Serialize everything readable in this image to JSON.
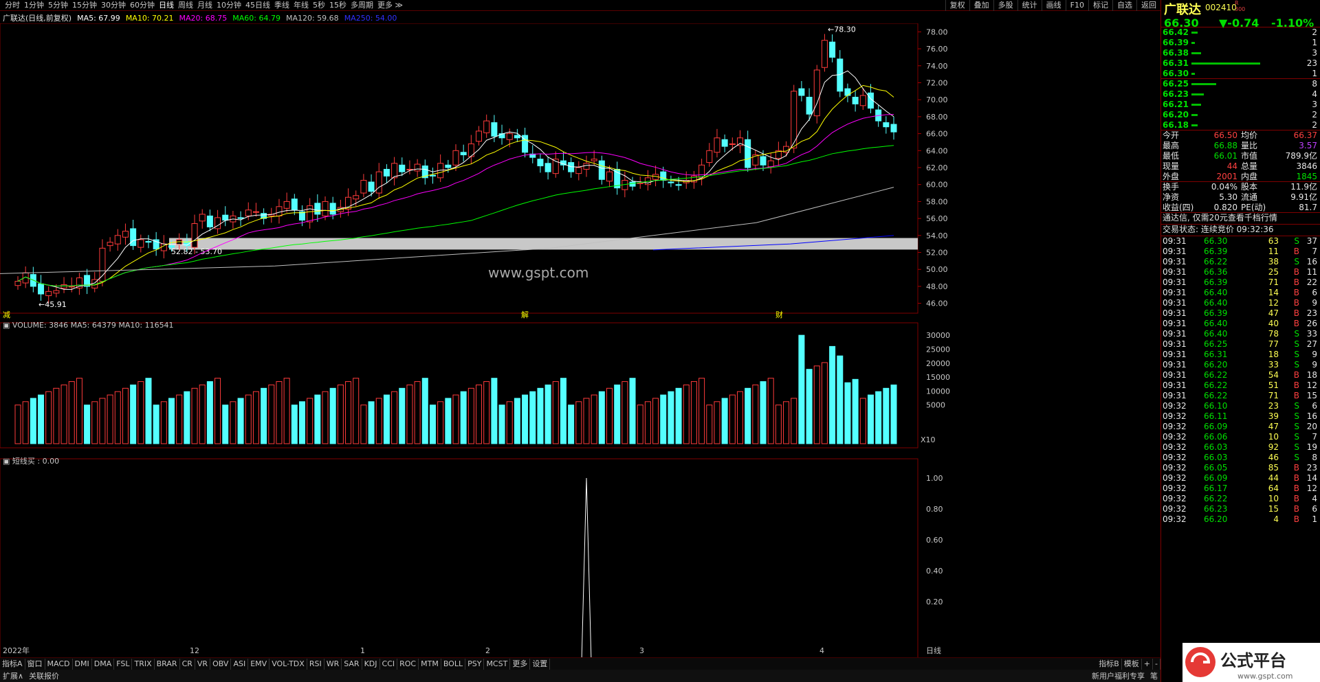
{
  "toolbar": {
    "periods": [
      "分时",
      "1分钟",
      "5分钟",
      "15分钟",
      "30分钟",
      "60分钟",
      "日线",
      "周线",
      "月线",
      "10分钟",
      "45日线",
      "季线",
      "年线",
      "5秒",
      "15秒",
      "多周期",
      "更多 ≫"
    ],
    "right": [
      "复权",
      "叠加",
      "多股",
      "统计",
      "画线",
      "F10",
      "标记",
      "自选",
      "返回"
    ]
  },
  "info": {
    "name": "广联达(日线,前复权)",
    "ma5": "MA5: 67.99",
    "ma10": "MA10: 70.21",
    "ma20": "MA20: 68.75",
    "ma60": "MA60: 64.79",
    "ma120": "MA120: 59.68",
    "ma250": "MA250: 54.00"
  },
  "colors": {
    "up": "#ff3b3b",
    "down": "#54ffff",
    "ma5": "#ffffff",
    "ma10": "#ffff00",
    "ma20": "#ff00ff",
    "ma60": "#00ff00",
    "ma120": "#c0c0c0",
    "ma250": "#0000ff",
    "panel_border": "#800000"
  },
  "chart_data": {
    "type": "candlestick",
    "price_axis": {
      "ticks": [
        "78.00",
        "76.00",
        "74.00",
        "72.00",
        "70.00",
        "68.00",
        "66.00",
        "64.00",
        "62.00",
        "60.00",
        "58.00",
        "56.00",
        "54.00",
        "52.00",
        "50.00",
        "48.00",
        "46.00"
      ],
      "ylim": [
        45,
        79
      ]
    },
    "annotations": {
      "high": "78.30",
      "low": "45.91",
      "zone": "52.82 - 53.70",
      "markers": [
        "减",
        "解",
        "财"
      ]
    },
    "closes": [
      48.6,
      49.6,
      48.0,
      47.1,
      47.4,
      47.5,
      48.2,
      48.0,
      49.0,
      48.0,
      48.8,
      52.5,
      53.2,
      54.0,
      54.5,
      52.8,
      53.5,
      53.2,
      52.4,
      53.0,
      52.6,
      53.5,
      52.8,
      55.4,
      56.5,
      55.0,
      56.1,
      55.8,
      56.3,
      56.0,
      57.0,
      56.8,
      56.0,
      56.5,
      57.4,
      58.0,
      57.0,
      55.8,
      57.5,
      56.5,
      58.0,
      56.5,
      57.3,
      58.5,
      58.7,
      60.5,
      59.2,
      61.5,
      61.0,
      62.5,
      61.5,
      61.8,
      62.4,
      60.8,
      61.0,
      62.5,
      62.0,
      64.0,
      63.5,
      64.8,
      66.3,
      67.5,
      65.7,
      65.5,
      66.0,
      65.5,
      63.8,
      63.2,
      62.2,
      61.5,
      63.0,
      62.3,
      61.5,
      62.0,
      62.5,
      63.0,
      60.6,
      61.5,
      59.6,
      60.5,
      59.8,
      60.2,
      60.8,
      61.2,
      60.5,
      60.2,
      59.9,
      60.5,
      61.0,
      62.3,
      64.0,
      65.5,
      64.5,
      64.8,
      65.5,
      62.0,
      63.5,
      62.3,
      62.8,
      64.0,
      64.5,
      71.0,
      70.5,
      68.3,
      73.5,
      77.0,
      75.0,
      71.0,
      70.5,
      69.5,
      70.5,
      69.0,
      67.5,
      66.8,
      66.2
    ]
  },
  "volume": {
    "label": "VOLUME: 3846",
    "ma5": "MA5: 64379",
    "ma10": "MA10: 116541",
    "ticks": [
      "30000",
      "25000",
      "20000",
      "15000",
      "10000",
      "5000"
    ],
    "unit": "X10"
  },
  "indicator": {
    "label": "短线买 : 0.00",
    "ticks": [
      "1.00",
      "0.80",
      "0.60",
      "0.40",
      "0.20"
    ]
  },
  "xaxis": {
    "labels": [
      "2022年",
      "12",
      "1",
      "2",
      "3",
      "4",
      "日线"
    ]
  },
  "tabs": [
    "指标A",
    "窗口",
    "MACD",
    "DMI",
    "DMA",
    "FSL",
    "TRIX",
    "BRAR",
    "CR",
    "VR",
    "OBV",
    "ASI",
    "EMV",
    "VOL-TDX",
    "RSI",
    "WR",
    "SAR",
    "KDJ",
    "CCI",
    "ROC",
    "MTM",
    "BOLL",
    "PSY",
    "MCST",
    "更多",
    "设置"
  ],
  "tabs_right": [
    "指标B",
    "模板",
    "+",
    "-"
  ],
  "bottom": {
    "left": [
      "扩展∧",
      "关联报价"
    ],
    "right": "新用户福利专享",
    "right2": "笔"
  },
  "watermark": "www.gspt.com",
  "quote": {
    "name": "广联达",
    "code": "002410",
    "r_mark": "R",
    "r_sub": "300",
    "price": "66.30",
    "change": "▼-0.74",
    "pct": "-1.10%",
    "asks": [
      [
        "66.42",
        "2"
      ],
      [
        "66.39",
        "1"
      ],
      [
        "66.38",
        "3"
      ],
      [
        "66.31",
        "23"
      ],
      [
        "66.30",
        "1"
      ]
    ],
    "bids": [
      [
        "66.25",
        "8"
      ],
      [
        "66.23",
        "4"
      ],
      [
        "66.21",
        "3"
      ],
      [
        "66.20",
        "2"
      ],
      [
        "66.18",
        "2"
      ]
    ],
    "stats": [
      [
        "今开",
        "66.50",
        "均价",
        "66.37"
      ],
      [
        "最高",
        "66.88",
        "量比",
        "3.57"
      ],
      [
        "最低",
        "66.01",
        "市值",
        "789.9亿"
      ],
      [
        "现量",
        "44",
        "总量",
        "3846"
      ],
      [
        "外盘",
        "2001",
        "内盘",
        "1845"
      ],
      [
        "换手",
        "0.04%",
        "股本",
        "11.9亿"
      ],
      [
        "净资",
        "5.30",
        "流通",
        "9.91亿"
      ],
      [
        "收益(四)",
        "0.820",
        "PE(动)",
        "81.7"
      ]
    ],
    "ad": "通达信, 仅需20元查看千档行情",
    "status": "交易状态: 连续竞价  09:32:36",
    "ticks": [
      [
        "09:31",
        "66.30",
        "63",
        "S",
        "37"
      ],
      [
        "09:31",
        "66.39",
        "11",
        "B",
        "7"
      ],
      [
        "09:31",
        "66.22",
        "38",
        "S",
        "16"
      ],
      [
        "09:31",
        "66.36",
        "25",
        "B",
        "11"
      ],
      [
        "09:31",
        "66.39",
        "71",
        "B",
        "22"
      ],
      [
        "09:31",
        "66.40",
        "14",
        "B",
        "6"
      ],
      [
        "09:31",
        "66.40",
        "12",
        "B",
        "9"
      ],
      [
        "09:31",
        "66.39",
        "47",
        "B",
        "23"
      ],
      [
        "09:31",
        "66.40",
        "40",
        "B",
        "26"
      ],
      [
        "09:31",
        "66.40",
        "78",
        "S",
        "33"
      ],
      [
        "09:31",
        "66.25",
        "77",
        "S",
        "27"
      ],
      [
        "09:31",
        "66.31",
        "18",
        "S",
        "9"
      ],
      [
        "09:31",
        "66.20",
        "33",
        "S",
        "9"
      ],
      [
        "09:31",
        "66.22",
        "54",
        "B",
        "18"
      ],
      [
        "09:31",
        "66.22",
        "51",
        "B",
        "12"
      ],
      [
        "09:31",
        "66.22",
        "71",
        "B",
        "15"
      ],
      [
        "09:32",
        "66.10",
        "23",
        "S",
        "6"
      ],
      [
        "09:32",
        "66.11",
        "39",
        "S",
        "16"
      ],
      [
        "09:32",
        "66.09",
        "47",
        "S",
        "20"
      ],
      [
        "09:32",
        "66.06",
        "10",
        "S",
        "7"
      ],
      [
        "09:32",
        "66.03",
        "92",
        "S",
        "19"
      ],
      [
        "09:32",
        "66.03",
        "46",
        "S",
        "8"
      ],
      [
        "09:32",
        "66.05",
        "85",
        "B",
        "23"
      ],
      [
        "09:32",
        "66.09",
        "44",
        "B",
        "14"
      ],
      [
        "09:32",
        "66.17",
        "64",
        "B",
        "12"
      ],
      [
        "09:32",
        "66.22",
        "10",
        "B",
        "4"
      ],
      [
        "09:32",
        "66.23",
        "15",
        "B",
        "6"
      ],
      [
        "09:32",
        "66.20",
        "4",
        "B",
        "1"
      ]
    ]
  },
  "logo": {
    "text": "公式平台",
    "url": "www.gspt.com"
  }
}
